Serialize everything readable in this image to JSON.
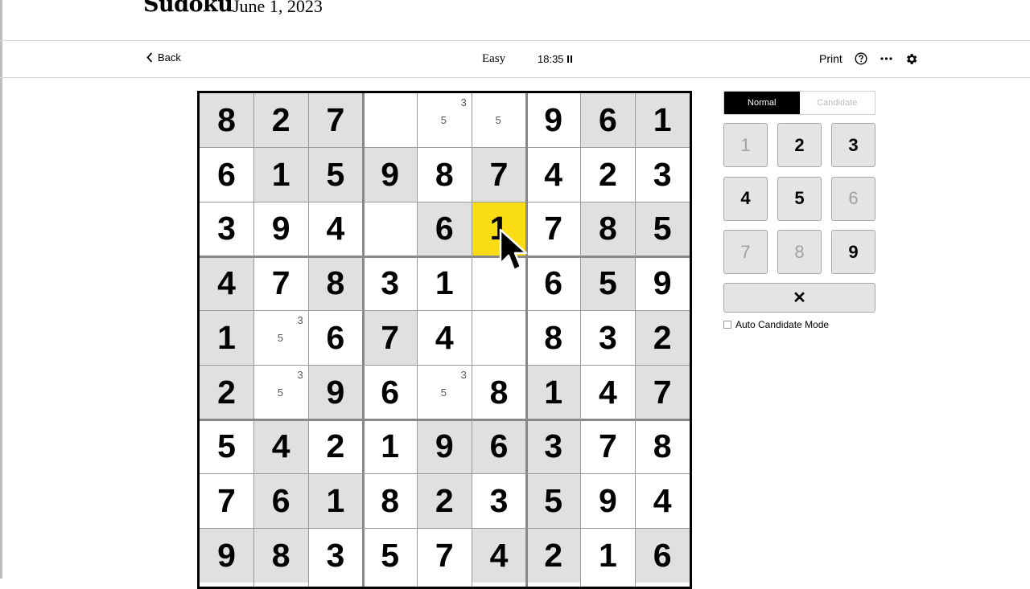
{
  "header": {
    "title": "Sudoku",
    "date": "June 1, 2023"
  },
  "toolbar": {
    "back_label": "Back",
    "level": "Easy",
    "timer": "18:35",
    "print_label": "Print"
  },
  "mode": {
    "normal": "Normal",
    "candidate": "Candidate",
    "active": "normal"
  },
  "board": {
    "rows": [
      [
        "8",
        "2",
        "7",
        "",
        "",
        "",
        "9",
        "6",
        "1"
      ],
      [
        "6",
        "1",
        "5",
        "9",
        "8",
        "7",
        "4",
        "2",
        "3"
      ],
      [
        "3",
        "9",
        "4",
        "",
        "6",
        "1",
        "7",
        "8",
        "5"
      ],
      [
        "4",
        "7",
        "8",
        "3",
        "1",
        "",
        "6",
        "5",
        "9"
      ],
      [
        "1",
        "",
        "6",
        "7",
        "4",
        "",
        "8",
        "3",
        "2"
      ],
      [
        "2",
        "",
        "9",
        "6",
        "",
        "8",
        "1",
        "4",
        "7"
      ],
      [
        "5",
        "4",
        "2",
        "1",
        "9",
        "6",
        "3",
        "7",
        "8"
      ],
      [
        "7",
        "6",
        "1",
        "8",
        "2",
        "3",
        "5",
        "9",
        "4"
      ],
      [
        "9",
        "8",
        "3",
        "5",
        "7",
        "4",
        "2",
        "1",
        "6"
      ]
    ],
    "given": [
      [
        1,
        1,
        1,
        0,
        0,
        0,
        0,
        1,
        1
      ],
      [
        0,
        1,
        1,
        1,
        0,
        1,
        0,
        0,
        0
      ],
      [
        0,
        0,
        0,
        0,
        1,
        0,
        0,
        1,
        1
      ],
      [
        1,
        0,
        1,
        0,
        0,
        0,
        0,
        1,
        0
      ],
      [
        1,
        0,
        0,
        1,
        0,
        0,
        0,
        0,
        1
      ],
      [
        1,
        0,
        1,
        0,
        0,
        0,
        1,
        0,
        1
      ],
      [
        0,
        1,
        0,
        0,
        1,
        1,
        1,
        0,
        0
      ],
      [
        0,
        1,
        1,
        0,
        1,
        0,
        1,
        0,
        0
      ],
      [
        1,
        1,
        0,
        0,
        0,
        1,
        1,
        0,
        1
      ]
    ],
    "selected": [
      2,
      5
    ],
    "candidates": {
      "0,4": [
        "3",
        "5"
      ],
      "0,5": [
        "5"
      ],
      "4,1": [
        "3",
        "5"
      ],
      "5,1": [
        "3",
        "5"
      ],
      "5,4": [
        "3",
        "5"
      ]
    }
  },
  "keypad": {
    "keys": [
      "1",
      "2",
      "3",
      "4",
      "5",
      "6",
      "7",
      "8",
      "9"
    ],
    "disabled": [
      "1",
      "6",
      "7",
      "8"
    ],
    "erase_label": "✕"
  },
  "auto_candidate_label": "Auto Candidate Mode",
  "icons": {
    "back": "chevron-left-icon",
    "pause": "pause-icon",
    "help": "question-circle-icon",
    "more": "ellipsis-icon",
    "settings": "gear-icon",
    "cursor": "mouse-pointer-icon"
  },
  "colors": {
    "given_bg": "#e0e0e0",
    "selected_bg": "#f9dc14",
    "mode_active_bg": "#000000"
  }
}
